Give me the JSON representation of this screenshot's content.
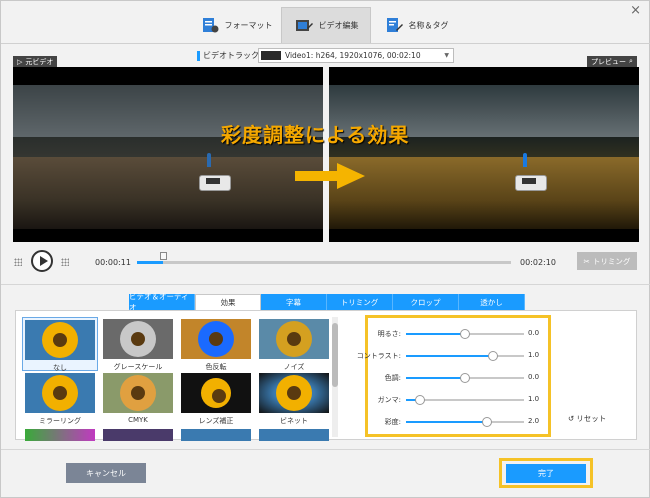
{
  "window": {
    "close_symbol": "×"
  },
  "top_tabs": [
    {
      "label": "フォーマット",
      "icon": "format-icon"
    },
    {
      "label": "ビデオ編集",
      "icon": "video-edit-icon",
      "active": true
    },
    {
      "label": "名称＆タグ",
      "icon": "tag-edit-icon"
    }
  ],
  "track": {
    "label": "ビデオトラック:",
    "value": "Video1: h264, 1920x1076, 00:02:10"
  },
  "preview": {
    "original_label": "元ビデオ",
    "preview_label": "プレビュー",
    "overlay_title": "彩度調整による効果"
  },
  "player": {
    "current_time": "00:00:11",
    "total_time": "00:02:10",
    "progress": 0.07,
    "trim_label": "トリミング"
  },
  "sub_tabs": [
    {
      "label": "ビデオ＆オーディオ"
    },
    {
      "label": "効果",
      "active": true
    },
    {
      "label": "字幕"
    },
    {
      "label": "トリミング"
    },
    {
      "label": "クロップ"
    },
    {
      "label": "透かし"
    }
  ],
  "effects": [
    {
      "label": "なし",
      "style": "normal",
      "selected": true
    },
    {
      "label": "グレースケール",
      "style": "gray"
    },
    {
      "label": "色反転",
      "style": "invert"
    },
    {
      "label": "ノイズ",
      "style": "noise"
    },
    {
      "label": "ミラーリング",
      "style": "mirror"
    },
    {
      "label": "CMYK",
      "style": "cmyk"
    },
    {
      "label": "レンズ補正",
      "style": "lens"
    },
    {
      "label": "ビネット",
      "style": "vignette"
    }
  ],
  "adjustments": [
    {
      "label": "明るさ:",
      "value": "0.0",
      "level": 0.5
    },
    {
      "label": "コントラスト:",
      "value": "1.0",
      "level": 0.74
    },
    {
      "label": "色調:",
      "value": "0.0",
      "level": 0.5
    },
    {
      "label": "ガンマ:",
      "value": "1.0",
      "level": 0.12
    },
    {
      "label": "彩度:",
      "value": "2.0",
      "level": 0.69
    }
  ],
  "reset_label": "リセット",
  "footer": {
    "cancel_label": "キャンセル",
    "done_label": "完了"
  },
  "colors": {
    "accent": "#1a9bff",
    "highlight": "#f5c227",
    "title": "#f5a800"
  }
}
